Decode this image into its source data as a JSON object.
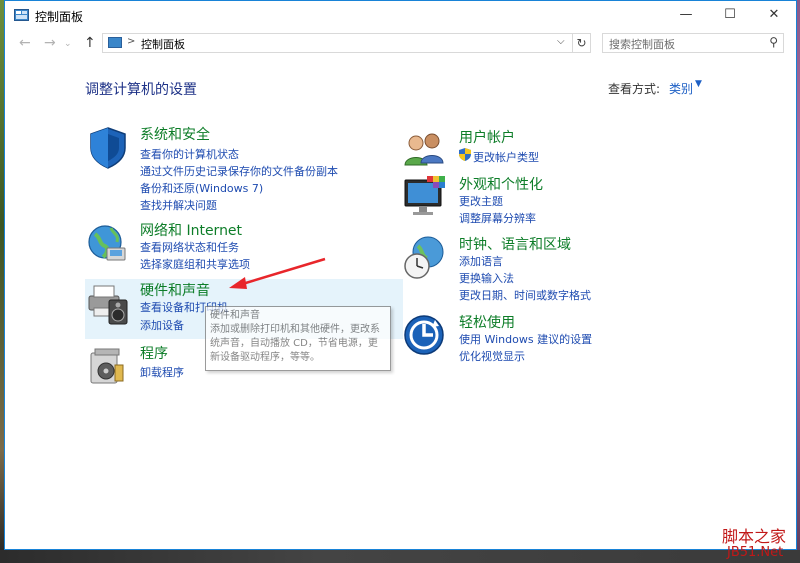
{
  "window": {
    "title": "控制面板",
    "controls": {
      "minimize": "—",
      "maximize": "☐",
      "close": "✕"
    }
  },
  "nav": {
    "back_glyph": "←",
    "forward_glyph": "→",
    "up_glyph": "↑",
    "address_separator": ">",
    "address_crumb": "控制面板",
    "dropdown_glyph": "⌵",
    "refresh_glyph": "↻",
    "search_placeholder": "搜索控制面板",
    "search_glyph": "⚲"
  },
  "page": {
    "heading": "调整计算机的设置",
    "view_by_label": "查看方式:",
    "view_by_value": "类别",
    "view_by_arrow": "▼"
  },
  "categories": {
    "security": {
      "title": "系统和安全",
      "icon": "shield-icon",
      "links": [
        "查看你的计算机状态",
        "通过文件历史记录保存你的文件备份副本",
        "备份和还原(Windows 7)",
        "查找并解决问题"
      ]
    },
    "network": {
      "title": "网络和 Internet",
      "icon": "globe-network-icon",
      "links": [
        "查看网络状态和任务",
        "选择家庭组和共享选项"
      ]
    },
    "hardware": {
      "title": "硬件和声音",
      "icon": "printer-speaker-icon",
      "links": [
        "查看设备和打印机",
        "添加设备"
      ]
    },
    "programs": {
      "title": "程序",
      "icon": "programs-icon",
      "links": [
        "卸载程序"
      ]
    },
    "users": {
      "title": "用户帐户",
      "icon": "users-icon",
      "links": [
        "更改帐户类型"
      ]
    },
    "appearance": {
      "title": "外观和个性化",
      "icon": "monitor-palette-icon",
      "links": [
        "更改主题",
        "调整屏幕分辨率"
      ]
    },
    "clock": {
      "title": "时钟、语言和区域",
      "icon": "clock-globe-icon",
      "links": [
        "添加语言",
        "更换输入法",
        "更改日期、时间或数字格式"
      ]
    },
    "ease": {
      "title": "轻松使用",
      "icon": "ease-of-access-icon",
      "links": [
        "使用 Windows 建议的设置",
        "优化视觉显示"
      ]
    }
  },
  "tooltip": {
    "title": "硬件和声音",
    "body": "添加或删除打印机和其他硬件，更改系统声音，自动播放 CD，节省电源，更新设备驱动程序，等等。"
  },
  "colors": {
    "category_title": "#0d7d28",
    "link": "#1e4bb0",
    "heading": "#1e3287",
    "hover": "#e5f3fb",
    "annotation_arrow": "#e8262b"
  },
  "watermark": {
    "line1": "脚本之家",
    "line2": "JB51.Net"
  }
}
